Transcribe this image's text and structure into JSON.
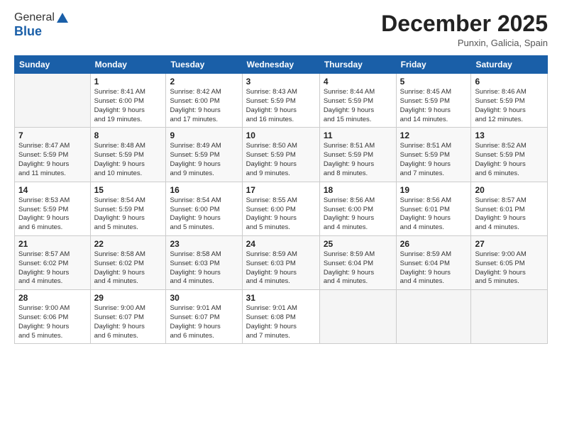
{
  "logo": {
    "general": "General",
    "blue": "Blue"
  },
  "header": {
    "month": "December 2025",
    "location": "Punxin, Galicia, Spain"
  },
  "weekdays": [
    "Sunday",
    "Monday",
    "Tuesday",
    "Wednesday",
    "Thursday",
    "Friday",
    "Saturday"
  ],
  "weeks": [
    [
      {
        "num": "",
        "info": ""
      },
      {
        "num": "1",
        "info": "Sunrise: 8:41 AM\nSunset: 6:00 PM\nDaylight: 9 hours\nand 19 minutes."
      },
      {
        "num": "2",
        "info": "Sunrise: 8:42 AM\nSunset: 6:00 PM\nDaylight: 9 hours\nand 17 minutes."
      },
      {
        "num": "3",
        "info": "Sunrise: 8:43 AM\nSunset: 5:59 PM\nDaylight: 9 hours\nand 16 minutes."
      },
      {
        "num": "4",
        "info": "Sunrise: 8:44 AM\nSunset: 5:59 PM\nDaylight: 9 hours\nand 15 minutes."
      },
      {
        "num": "5",
        "info": "Sunrise: 8:45 AM\nSunset: 5:59 PM\nDaylight: 9 hours\nand 14 minutes."
      },
      {
        "num": "6",
        "info": "Sunrise: 8:46 AM\nSunset: 5:59 PM\nDaylight: 9 hours\nand 12 minutes."
      }
    ],
    [
      {
        "num": "7",
        "info": "Sunrise: 8:47 AM\nSunset: 5:59 PM\nDaylight: 9 hours\nand 11 minutes."
      },
      {
        "num": "8",
        "info": "Sunrise: 8:48 AM\nSunset: 5:59 PM\nDaylight: 9 hours\nand 10 minutes."
      },
      {
        "num": "9",
        "info": "Sunrise: 8:49 AM\nSunset: 5:59 PM\nDaylight: 9 hours\nand 9 minutes."
      },
      {
        "num": "10",
        "info": "Sunrise: 8:50 AM\nSunset: 5:59 PM\nDaylight: 9 hours\nand 9 minutes."
      },
      {
        "num": "11",
        "info": "Sunrise: 8:51 AM\nSunset: 5:59 PM\nDaylight: 9 hours\nand 8 minutes."
      },
      {
        "num": "12",
        "info": "Sunrise: 8:51 AM\nSunset: 5:59 PM\nDaylight: 9 hours\nand 7 minutes."
      },
      {
        "num": "13",
        "info": "Sunrise: 8:52 AM\nSunset: 5:59 PM\nDaylight: 9 hours\nand 6 minutes."
      }
    ],
    [
      {
        "num": "14",
        "info": "Sunrise: 8:53 AM\nSunset: 5:59 PM\nDaylight: 9 hours\nand 6 minutes."
      },
      {
        "num": "15",
        "info": "Sunrise: 8:54 AM\nSunset: 5:59 PM\nDaylight: 9 hours\nand 5 minutes."
      },
      {
        "num": "16",
        "info": "Sunrise: 8:54 AM\nSunset: 6:00 PM\nDaylight: 9 hours\nand 5 minutes."
      },
      {
        "num": "17",
        "info": "Sunrise: 8:55 AM\nSunset: 6:00 PM\nDaylight: 9 hours\nand 5 minutes."
      },
      {
        "num": "18",
        "info": "Sunrise: 8:56 AM\nSunset: 6:00 PM\nDaylight: 9 hours\nand 4 minutes."
      },
      {
        "num": "19",
        "info": "Sunrise: 8:56 AM\nSunset: 6:01 PM\nDaylight: 9 hours\nand 4 minutes."
      },
      {
        "num": "20",
        "info": "Sunrise: 8:57 AM\nSunset: 6:01 PM\nDaylight: 9 hours\nand 4 minutes."
      }
    ],
    [
      {
        "num": "21",
        "info": "Sunrise: 8:57 AM\nSunset: 6:02 PM\nDaylight: 9 hours\nand 4 minutes."
      },
      {
        "num": "22",
        "info": "Sunrise: 8:58 AM\nSunset: 6:02 PM\nDaylight: 9 hours\nand 4 minutes."
      },
      {
        "num": "23",
        "info": "Sunrise: 8:58 AM\nSunset: 6:03 PM\nDaylight: 9 hours\nand 4 minutes."
      },
      {
        "num": "24",
        "info": "Sunrise: 8:59 AM\nSunset: 6:03 PM\nDaylight: 9 hours\nand 4 minutes."
      },
      {
        "num": "25",
        "info": "Sunrise: 8:59 AM\nSunset: 6:04 PM\nDaylight: 9 hours\nand 4 minutes."
      },
      {
        "num": "26",
        "info": "Sunrise: 8:59 AM\nSunset: 6:04 PM\nDaylight: 9 hours\nand 4 minutes."
      },
      {
        "num": "27",
        "info": "Sunrise: 9:00 AM\nSunset: 6:05 PM\nDaylight: 9 hours\nand 5 minutes."
      }
    ],
    [
      {
        "num": "28",
        "info": "Sunrise: 9:00 AM\nSunset: 6:06 PM\nDaylight: 9 hours\nand 5 minutes."
      },
      {
        "num": "29",
        "info": "Sunrise: 9:00 AM\nSunset: 6:07 PM\nDaylight: 9 hours\nand 6 minutes."
      },
      {
        "num": "30",
        "info": "Sunrise: 9:01 AM\nSunset: 6:07 PM\nDaylight: 9 hours\nand 6 minutes."
      },
      {
        "num": "31",
        "info": "Sunrise: 9:01 AM\nSunset: 6:08 PM\nDaylight: 9 hours\nand 7 minutes."
      },
      {
        "num": "",
        "info": ""
      },
      {
        "num": "",
        "info": ""
      },
      {
        "num": "",
        "info": ""
      }
    ]
  ]
}
